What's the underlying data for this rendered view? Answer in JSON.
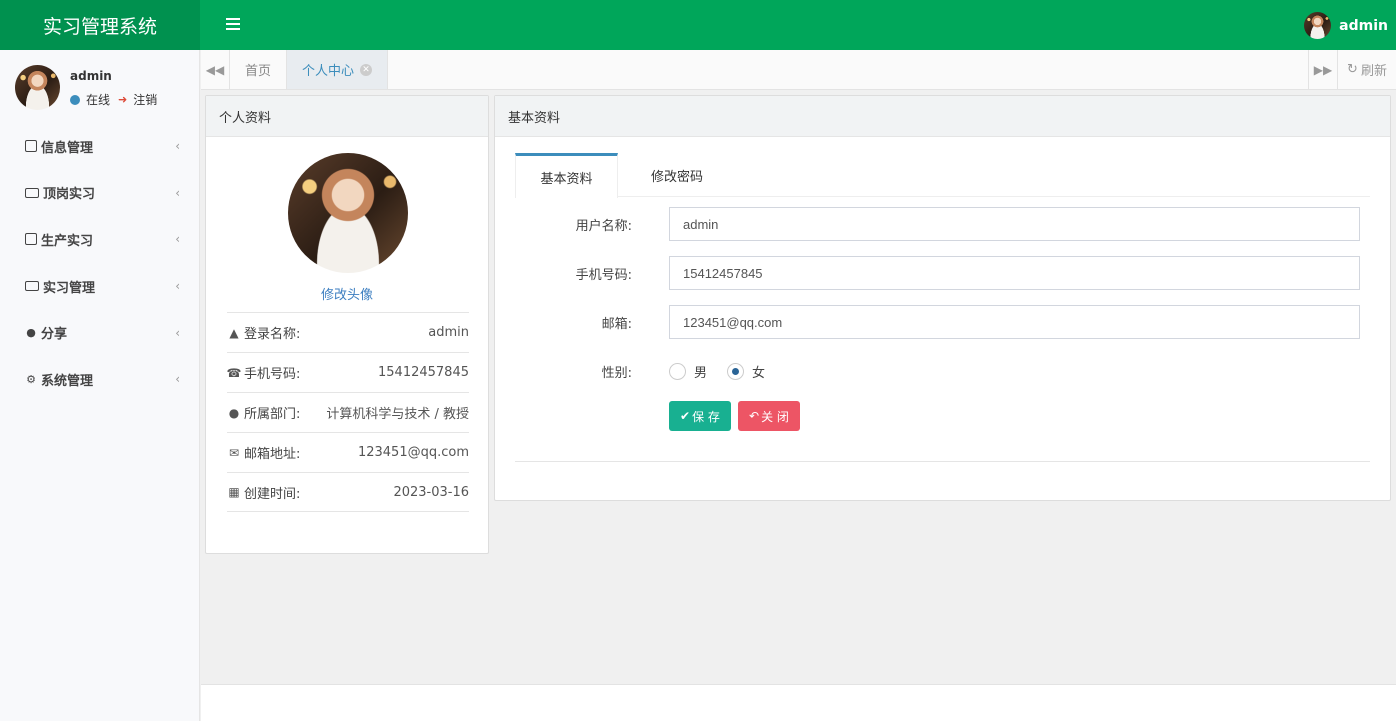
{
  "app": {
    "title": "实习管理系统"
  },
  "topbar": {
    "username": "admin"
  },
  "sidebar": {
    "username": "admin",
    "status": "在线",
    "logout": "注销",
    "items": [
      {
        "label": "信息管理",
        "icon": "contact-card-icon"
      },
      {
        "label": "顶岗实习",
        "icon": "id-card-icon"
      },
      {
        "label": "生产实习",
        "icon": "badge-icon"
      },
      {
        "label": "实习管理",
        "icon": "id-card-icon"
      },
      {
        "label": "分享",
        "icon": "comment-icon"
      },
      {
        "label": "系统管理",
        "icon": "gear-icon"
      }
    ]
  },
  "tabs": {
    "home": "首页",
    "profile": "个人中心",
    "refresh": "刷新"
  },
  "profile": {
    "panel_title": "个人资料",
    "change_avatar": "修改头像",
    "info": [
      {
        "label": "登录名称:",
        "value": "admin",
        "icon": "user-icon"
      },
      {
        "label": "手机号码:",
        "value": "15412457845",
        "icon": "phone-icon"
      },
      {
        "label": "所属部门:",
        "value": "计算机科学与技术 / 教授",
        "icon": "users-icon"
      },
      {
        "label": "邮箱地址:",
        "value": "123451@qq.com",
        "icon": "envelope-icon"
      },
      {
        "label": "创建时间:",
        "value": "2023-03-16",
        "icon": "calendar-icon"
      }
    ]
  },
  "basic": {
    "panel_title": "基本资料",
    "tab_basic": "基本资料",
    "tab_password": "修改密码",
    "username_label": "用户名称:",
    "username_value": "admin",
    "phone_label": "手机号码:",
    "phone_value": "15412457845",
    "email_label": "邮箱:",
    "email_value": "123451@qq.com",
    "gender_label": "性别:",
    "gender_male": "男",
    "gender_female": "女",
    "gender_selected": "女",
    "save_label": "保 存",
    "close_label": "关 闭"
  },
  "colors": {
    "header": "#00a65a",
    "logo_bg": "#00914f",
    "save": "#18b091",
    "close": "#ed5565",
    "accent": "#3c8dbc"
  }
}
